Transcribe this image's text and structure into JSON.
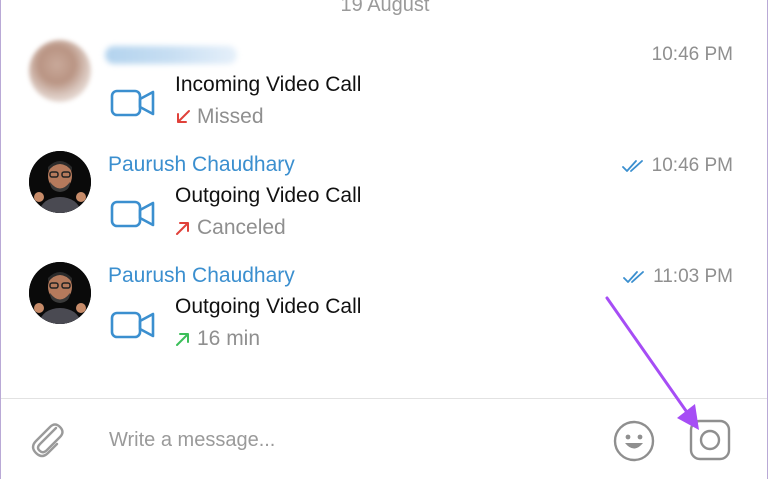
{
  "date_header": "19 August",
  "messages": [
    {
      "sender": "",
      "sender_redacted": true,
      "time": "10:46 PM",
      "read_checks": false,
      "call_title": "Incoming Video Call",
      "status": "Missed",
      "status_color": "#e0413a",
      "direction": "incoming"
    },
    {
      "sender": "Paurush Chaudhary",
      "sender_redacted": false,
      "time": "10:46 PM",
      "read_checks": true,
      "call_title": "Outgoing Video Call",
      "status": "Canceled",
      "status_color": "#e0413a",
      "direction": "outgoing"
    },
    {
      "sender": "Paurush Chaudhary",
      "sender_redacted": false,
      "time": "11:03 PM",
      "read_checks": true,
      "call_title": "Outgoing Video Call",
      "status": "16 min",
      "status_color": "#3cbf5a",
      "direction": "outgoing"
    }
  ],
  "composer": {
    "placeholder": "Write a message...",
    "value": ""
  },
  "icons": {
    "attach": "paperclip-icon",
    "emoji": "smiley-icon",
    "camera": "camera-icon",
    "call": "video-camera-icon"
  },
  "colors": {
    "accent": "#3b8fcf",
    "pointer": "#a64df5"
  }
}
